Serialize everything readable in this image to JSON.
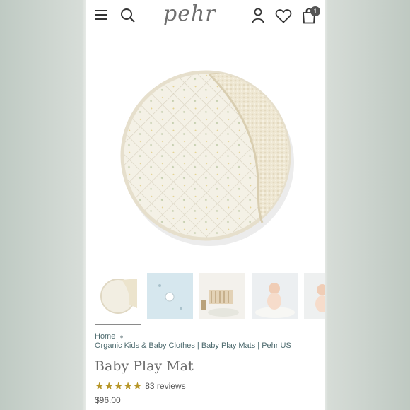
{
  "header": {
    "logo": "pehr",
    "cart_count": "1",
    "icons": [
      "menu-icon",
      "search-icon",
      "account-icon",
      "heart-icon",
      "bag-icon"
    ]
  },
  "breadcrumb": {
    "home": "Home",
    "current": "Organic Kids & Baby Clothes | Baby Play Mats | Pehr US"
  },
  "product": {
    "title": "Baby Play Mat",
    "stars": "★★★★★",
    "rating": 5,
    "reviews": "83 reviews",
    "price": "$96.00"
  },
  "colors": {
    "accent_star": "#b69526",
    "link": "#4d6a6e",
    "badge": "#555555"
  }
}
